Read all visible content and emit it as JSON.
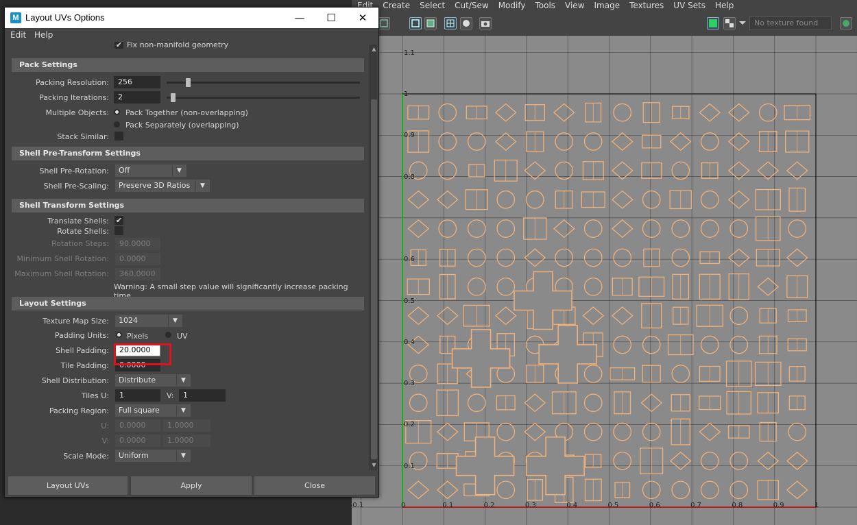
{
  "uv_editor": {
    "menu": [
      "Edit",
      "Create",
      "Select",
      "Cut/Sew",
      "Modify",
      "Tools",
      "View",
      "Image",
      "Textures",
      "UV Sets",
      "Help"
    ],
    "texture_field": "No texture found",
    "left_axis_labels": [
      "1.1",
      "1",
      "0.9",
      "0.8",
      "0.6",
      "0.5",
      "0.4",
      "0.3",
      "0.2",
      "0.1"
    ],
    "bottom_axis_labels": [
      "-0.1",
      "0",
      "0.1",
      "0.2",
      "0.3",
      "0.4",
      "0.5",
      "0.6",
      "0.7",
      "0.8",
      "0.9",
      "1"
    ],
    "colors": {
      "viewport": "#8a8a8a",
      "uv_shells": "#f0b079",
      "grid": "#1e1e1e",
      "u_axis": "#d00000",
      "v_axis": "#00c000"
    }
  },
  "dialog": {
    "title": "Layout UVs Options",
    "menu": {
      "edit": "Edit",
      "help": "Help"
    },
    "top_checkbox_label": "Fix non-manifold geometry",
    "pack": {
      "header": "Pack Settings",
      "resolution_label": "Packing Resolution:",
      "resolution_value": "256",
      "resolution_level": 0.1,
      "iterations_label": "Packing Iterations:",
      "iterations_value": "2",
      "iterations_level": 0.02,
      "multiple_label": "Multiple Objects:",
      "together": "Pack Together (non-overlapping)",
      "separately": "Pack Separately (overlapping)",
      "stack_label": "Stack Similar:"
    },
    "pre": {
      "header": "Shell Pre-Transform Settings",
      "rotation_label": "Shell Pre-Rotation:",
      "rotation_value": "Off",
      "scaling_label": "Shell Pre-Scaling:",
      "scaling_value": "Preserve 3D Ratios"
    },
    "transform": {
      "header": "Shell Transform Settings",
      "translate_label": "Translate Shells:",
      "rotate_label": "Rotate Shells:",
      "steps_label": "Rotation Steps:",
      "steps_value": "90.0000",
      "min_label": "Minimum Shell Rotation:",
      "min_value": "0.0000",
      "max_label": "Maximum Shell Rotation:",
      "max_value": "360.0000",
      "warning": "Warning: A small step value will significantly increase packing time."
    },
    "layout": {
      "header": "Layout Settings",
      "texsize_label": "Texture Map Size:",
      "texsize_value": "1024",
      "units_label": "Padding Units:",
      "pixels": "Pixels",
      "uv": "UV",
      "shell_padding_label": "Shell Padding:",
      "shell_padding_value": "20.0000",
      "tile_padding_label": "Tile Padding:",
      "tile_padding_value": "0.0000",
      "distribution_label": "Shell Distribution:",
      "distribution_value": "Distribute",
      "tiles_u_label": "Tiles U:",
      "tiles_u_value": "1",
      "tiles_v_label": "V:",
      "tiles_v_value": "1",
      "region_label": "Packing Region:",
      "region_value": "Full square",
      "u_label": "U:",
      "u_min": "0.0000",
      "u_max": "1.0000",
      "v_label": "V:",
      "v_min": "0.0000",
      "v_max": "1.0000",
      "scale_label": "Scale Mode:",
      "scale_value": "Uniform"
    },
    "buttons": {
      "layout": "Layout UVs",
      "apply": "Apply",
      "close": "Close"
    }
  }
}
